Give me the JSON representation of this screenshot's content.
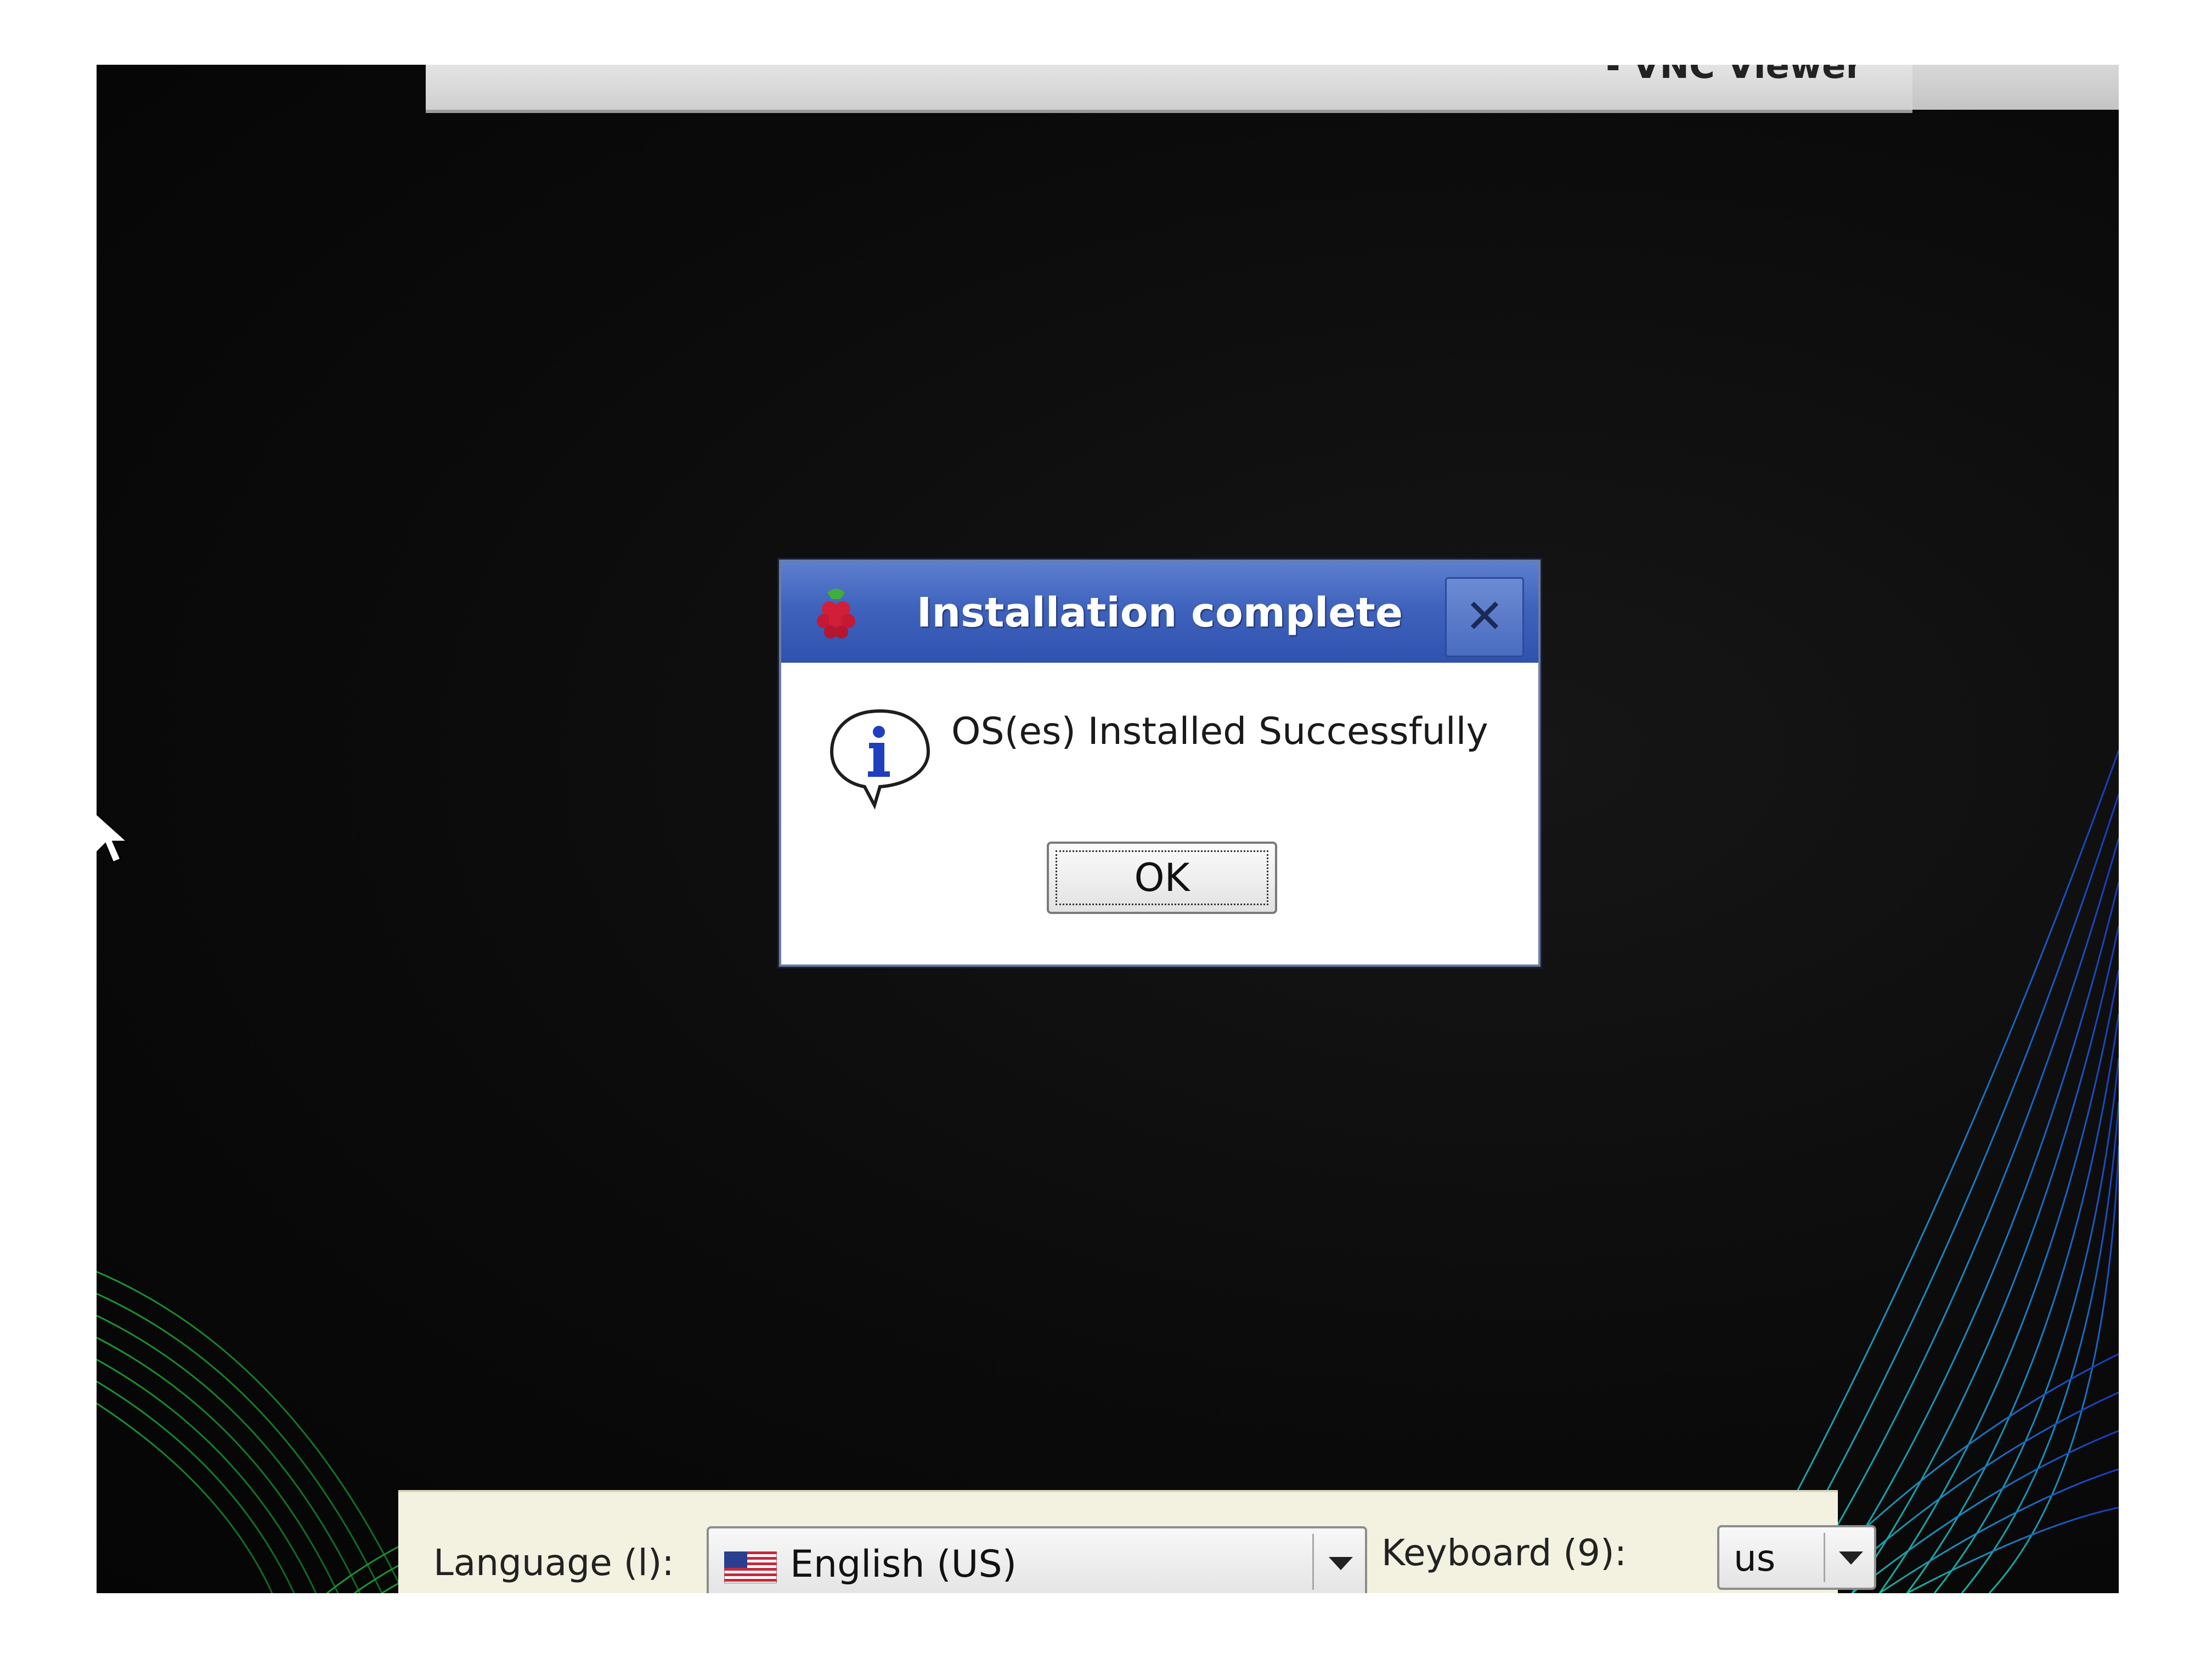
{
  "vnc_window": {
    "title": "- VNC Viewer"
  },
  "dialog": {
    "title": "Installation complete",
    "app_icon": "raspberry-icon",
    "close_icon": "close-icon",
    "close_glyph": "✕",
    "message_icon": "info-icon",
    "message": "OS(es) Installed Successfully",
    "ok_label": "OK"
  },
  "bottom_bar": {
    "language_label": "Language (l):",
    "language_value": "English (US)",
    "language_flag_icon": "us-flag-icon",
    "keyboard_label": "Keyboard (9):",
    "keyboard_value": "us",
    "dropdown_icon": "chevron-down-icon"
  },
  "colors": {
    "dialog_titlebar": "#3f63bd",
    "dialog_title_text": "#ffffff",
    "bottom_bar_bg": "#f3f1e0",
    "desktop_bg": "#0b0b0b"
  }
}
